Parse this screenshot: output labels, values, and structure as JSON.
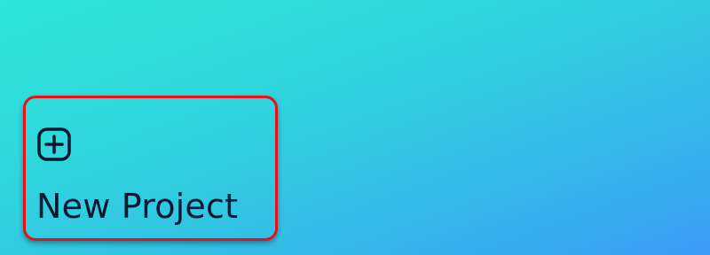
{
  "tile": {
    "icon": "plus-square-icon",
    "label": "New Project"
  },
  "colors": {
    "gradient_start": "#2de6d6",
    "gradient_end": "#3b9bf7",
    "highlight_border": "#e8101b",
    "text": "#0e1730"
  }
}
